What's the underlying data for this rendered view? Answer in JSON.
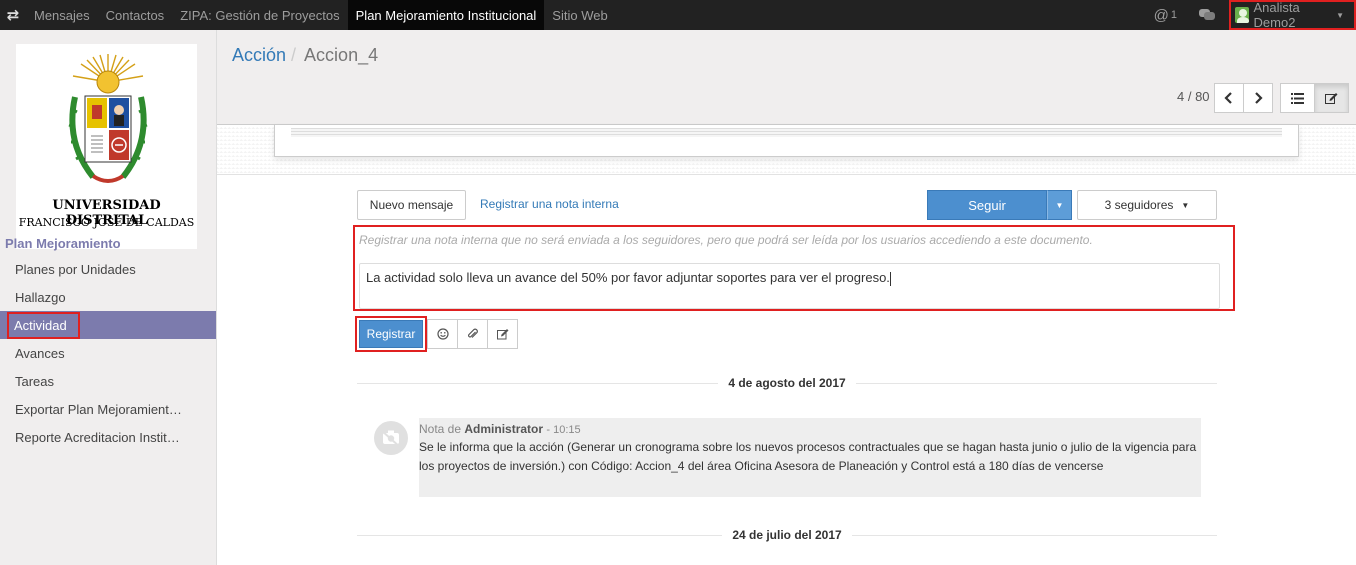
{
  "topbar": {
    "menu": [
      "Mensajes",
      "Contactos",
      "ZIPA: Gestión de Proyectos",
      "Plan Mejoramiento Institucional",
      "Sitio Web"
    ],
    "active_index": 3,
    "mentions_count": "1",
    "user_name": "Analista Demo2"
  },
  "sidebar": {
    "logo_line1": "UNIVERSIDAD DISTRITAL",
    "logo_line2": "FRANCISCO JOSÉ DE CALDAS",
    "section_title": "Plan Mejoramiento",
    "items": [
      "Planes por Unidades",
      "Hallazgo",
      "Actividad",
      "Avances",
      "Tareas",
      "Exportar Plan Mejoramient…",
      "Reporte Acreditacion Instit…"
    ]
  },
  "header": {
    "breadcrumb_parent": "Acción",
    "breadcrumb_current": "Accion_4",
    "pager": "4 / 80"
  },
  "chatter": {
    "new_message": "Nuevo mensaje",
    "log_note": "Registrar una nota interna",
    "follow": "Seguir",
    "followers": "3 seguidores",
    "composer_hint": "Registrar una nota interna que no será enviada a los seguidores, pero que podrá ser leída por los usuarios accediendo a este documento.",
    "composer_text": "La actividad solo lleva un avance del 50% por favor adjuntar soportes para ver el progreso.",
    "register_button": "Registrar",
    "date1": "4 de agosto del 2017",
    "message": {
      "prefix": "Nota de",
      "author": "Administrator",
      "time": "- 10:15",
      "body": "Se le informa que la acción (Generar un cronograma sobre los nuevos procesos contractuales que se hagan hasta junio o julio de la vigencia para los proyectos de inversión.) con Código: Accion_4 del área Oficina Asesora de Planeación y Control está a 180 días de vencerse"
    },
    "date2": "24 de julio del 2017"
  },
  "colors": {
    "topbar": "#222222",
    "accent": "#7c7bad",
    "primary": "#4c8fcf",
    "highlight": "#e02020"
  }
}
